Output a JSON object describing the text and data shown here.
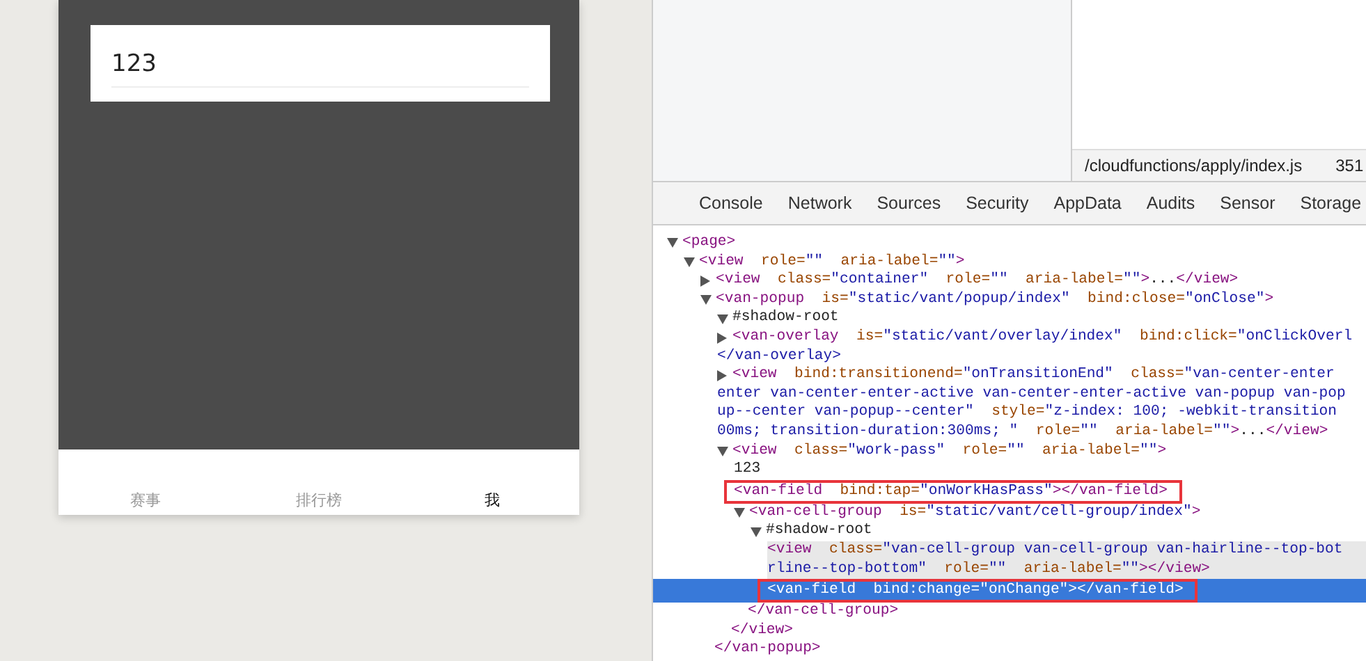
{
  "phone": {
    "field": {
      "value": "123"
    },
    "tabbar": [
      {
        "label": "赛事",
        "selected": false
      },
      {
        "label": "排行榜",
        "selected": false
      },
      {
        "label": "我",
        "selected": true
      }
    ]
  },
  "devtools": {
    "source_location": {
      "path": "/cloudfunctions/apply/index.js",
      "line": "351"
    },
    "tabs": [
      {
        "label": "Console",
        "selected": false
      },
      {
        "label": "Network",
        "selected": false
      },
      {
        "label": "Sources",
        "selected": false
      },
      {
        "label": "Security",
        "selected": false
      },
      {
        "label": "AppData",
        "selected": false
      },
      {
        "label": "Audits",
        "selected": false
      },
      {
        "label": "Sensor",
        "selected": false
      },
      {
        "label": "Storage",
        "selected": false
      }
    ],
    "tree": [
      {
        "kind": "element",
        "expanded": true,
        "selected": false,
        "hovered": false,
        "lines": [
          "<page>"
        ],
        "children": [
          {
            "kind": "element",
            "expanded": true,
            "selected": false,
            "hovered": false,
            "lines": [
              "<view  role=\"\"  aria-label=\"\">"
            ],
            "children": [
              {
                "kind": "element",
                "expanded": false,
                "selected": false,
                "hovered": false,
                "lines": [
                  "<view  class=\"container\"  role=\"\"  aria-label=\"\">...</view>"
                ]
              },
              {
                "kind": "element",
                "expanded": true,
                "selected": false,
                "hovered": false,
                "lines": [
                  "<van-popup  is=\"static/vant/popup/index\"  bind:close=\"onClose\">"
                ],
                "closing": "</van-popup>",
                "children": [
                  {
                    "kind": "element",
                    "expanded": true,
                    "selected": false,
                    "hovered": false,
                    "lines": [
                      "#shadow-root"
                    ]
                  },
                  {
                    "kind": "element",
                    "expanded": false,
                    "selected": false,
                    "hovered": false,
                    "lines": [
                      "<van-overlay  is=\"static/vant/overlay/index\"  bind:click=\"onClickOverl",
                      "</van-overlay>"
                    ]
                  },
                  {
                    "kind": "element",
                    "expanded": false,
                    "selected": false,
                    "hovered": false,
                    "lines": [
                      "<view  bind:transitionend=\"onTransitionEnd\"  class=\"van-center-enter",
                      "enter van-center-enter-active van-center-enter-active van-popup van-pop",
                      "up--center van-popup--center\"  style=\"z-index: 100; -webkit-transition",
                      "00ms; transition-duration:300ms; \"  role=\"\"  aria-label=\"\">...</view>"
                    ]
                  },
                  {
                    "kind": "element",
                    "expanded": true,
                    "selected": false,
                    "hovered": false,
                    "lines": [
                      "<view  class=\"work-pass\"  role=\"\"  aria-label=\"\">"
                    ],
                    "closing": "</view>",
                    "children": [
                      {
                        "kind": "leaf",
                        "selected": false,
                        "hovered": false,
                        "lines": [
                          "123"
                        ]
                      },
                      {
                        "kind": "leaf",
                        "selected": false,
                        "hovered": false,
                        "boxed": true,
                        "lines": [
                          "<van-field  bind:tap=\"onWorkHasPass\"></van-field>"
                        ]
                      },
                      {
                        "kind": "element",
                        "expanded": true,
                        "selected": false,
                        "hovered": false,
                        "lines": [
                          "<van-cell-group  is=\"static/vant/cell-group/index\">"
                        ],
                        "closing": "</van-cell-group>",
                        "children": [
                          {
                            "kind": "element",
                            "expanded": true,
                            "selected": false,
                            "hovered": false,
                            "lines": [
                              "#shadow-root"
                            ],
                            "children": [
                              {
                                "kind": "leaf",
                                "selected": false,
                                "hovered": true,
                                "lines": [
                                  "<view  class=\"van-cell-group van-cell-group van-hairline--top-bot",
                                  "rline--top-bottom\"  role=\"\"  aria-label=\"\"></view>"
                                ]
                              },
                              {
                                "kind": "leaf",
                                "selected": true,
                                "hovered": false,
                                "boxed": true,
                                "lines": [
                                  "<van-field  bind:change=\"onChange\"></van-field>"
                                ]
                              }
                            ]
                          }
                        ]
                      }
                    ]
                  }
                ]
              }
            ]
          }
        ]
      }
    ]
  }
}
